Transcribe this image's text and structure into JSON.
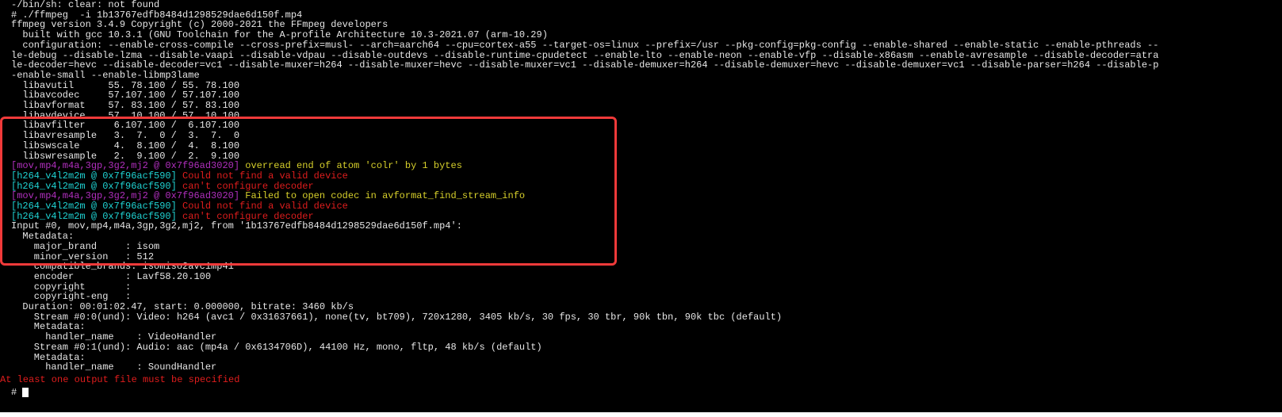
{
  "colors": {
    "background": "#000000",
    "text": "#e6e6e6",
    "tag_mov": "#b12fbe",
    "tag_h264": "#1fd2d2",
    "warning": "#d6cf2b",
    "error": "#e01d1d",
    "annotation_box": "#f03a3a"
  },
  "terminal": {
    "lines": [
      "-/bin/sh: clear: not found",
      "# ./ffmpeg  -i 1b13767edfb8484d1298529dae6d150f.mp4",
      "ffmpeg version 3.4.9 Copyright (c) 2000-2021 the FFmpeg developers",
      "  built with gcc 10.3.1 (GNU Toolchain for the A-profile Architecture 10.3-2021.07 (arm-10.29)",
      "  configuration: --enable-cross-compile --cross-prefix=musl- --arch=aarch64 --cpu=cortex-a55 --target-os=linux --prefix=/usr --pkg-config=pkg-config --enable-shared --enable-static --enable-pthreads --",
      "le-debug --disable-lzma --disable-vaapi --disable-vdpau --disable-outdevs --disable-runtime-cpudetect --enable-lto --enable-neon --enable-vfp --disable-x86asm --enable-avresample --disable-decoder=atra",
      "le-decoder=hevc --disable-decoder=vc1 --disable-muxer=h264 --disable-muxer=hevc --disable-muxer=vc1 --disable-demuxer=h264 --disable-demuxer=hevc --disable-demuxer=vc1 --disable-parser=h264 --disable-p",
      "-enable-small --enable-libmp3lame",
      "  libavutil      55. 78.100 / 55. 78.100",
      "  libavcodec     57.107.100 / 57.107.100",
      "  libavformat    57. 83.100 / 57. 83.100",
      "  libavdevice    57. 10.100 / 57. 10.100",
      "  libavfilter     6.107.100 /  6.107.100",
      "  libavresample   3.  7.  0 /  3.  7.  0",
      "  libswscale      4.  8.100 /  4.  8.100",
      "  libswresample   2.  9.100 /  2.  9.100"
    ],
    "log": [
      {
        "tag": "[mov,mp4,m4a,3gp,3g2,mj2 @ 0x7f96ad3020]",
        "tag_color": "purple",
        "message": " overread end of atom 'colr' by 1 bytes",
        "message_color": "yellow"
      },
      {
        "tag": "[h264_v4l2m2m @ 0x7f96acf590]",
        "tag_color": "cyan",
        "message": " Could not find a valid device",
        "message_color": "red"
      },
      {
        "tag": "[h264_v4l2m2m @ 0x7f96acf590]",
        "tag_color": "cyan",
        "message": " can't configure decoder",
        "message_color": "red"
      },
      {
        "tag": "[mov,mp4,m4a,3gp,3g2,mj2 @ 0x7f96ad3020]",
        "tag_color": "purple",
        "message": " Failed to open codec in avformat_find_stream_info",
        "message_color": "yellow"
      },
      {
        "tag": "[h264_v4l2m2m @ 0x7f96acf590]",
        "tag_color": "cyan",
        "message": " Could not find a valid device",
        "message_color": "red"
      },
      {
        "tag": "[h264_v4l2m2m @ 0x7f96acf590]",
        "tag_color": "cyan",
        "message": " can't configure decoder",
        "message_color": "red"
      }
    ],
    "info_lines": [
      "Input #0, mov,mp4,m4a,3gp,3g2,mj2, from '1b13767edfb8484d1298529dae6d150f.mp4':",
      "  Metadata:",
      "    major_brand     : isom",
      "    minor_version   : 512",
      "    compatible_brands: isomiso2avc1mp41",
      "    encoder         : Lavf58.20.100",
      "    copyright       :",
      "    copyright-eng   :",
      "  Duration: 00:01:02.47, start: 0.000000, bitrate: 3460 kb/s",
      "    Stream #0:0(und): Video: h264 (avc1 / 0x31637661), none(tv, bt709), 720x1280, 3405 kb/s, 30 fps, 30 tbr, 90k tbn, 90k tbc (default)",
      "    Metadata:",
      "      handler_name    : VideoHandler",
      "    Stream #0:1(und): Audio: aac (mp4a / 0x6134706D), 44100 Hz, mono, fltp, 48 kb/s (default)",
      "    Metadata:",
      "      handler_name    : SoundHandler"
    ],
    "final_error": "At least one output file must be specified",
    "prompt": "#"
  }
}
